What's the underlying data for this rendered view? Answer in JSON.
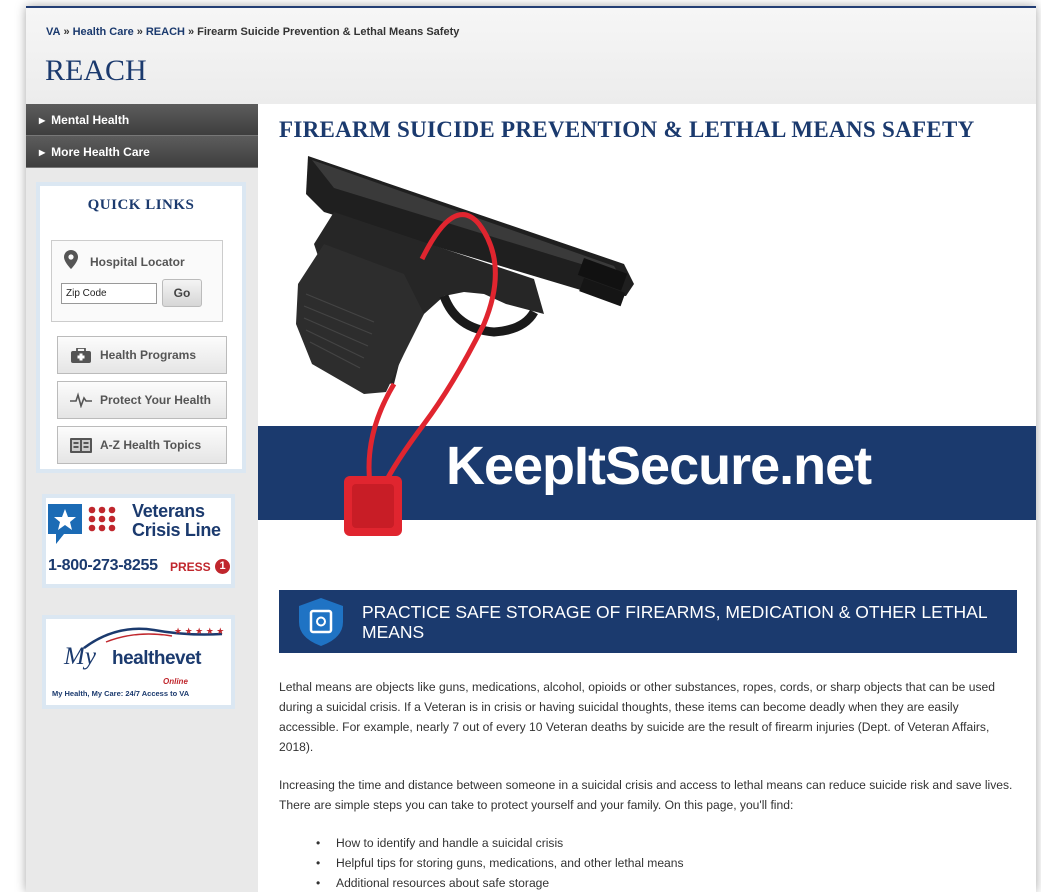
{
  "breadcrumb": {
    "items": [
      "VA",
      "Health Care",
      "REACH",
      "Firearm Suicide Prevention & Lethal Means Safety"
    ],
    "separator": "»"
  },
  "site": {
    "title": "REACH"
  },
  "sidebar": {
    "nav": [
      {
        "label": "Mental Health"
      },
      {
        "label": "More Health Care"
      }
    ],
    "quick_links": {
      "title": "QUICK LINKS",
      "locator": {
        "label": "Hospital Locator",
        "placeholder": "Zip Code",
        "go_label": "Go",
        "icon": "map-pin-icon"
      },
      "buttons": [
        {
          "label": "Health Programs",
          "icon": "first-aid-kit-icon"
        },
        {
          "label": "Protect Your Health",
          "icon": "heartbeat-icon"
        },
        {
          "label": "A-Z Health Topics",
          "icon": "az-topics-icon"
        }
      ]
    },
    "crisis_line": {
      "line1": "Veterans",
      "line2": "Crisis Line",
      "phone": "1-800-273-8255",
      "press": "PRESS",
      "press_number": "1"
    },
    "myhealthevet": {
      "logo_my": "My",
      "logo_name": "healthevet",
      "online": "Online",
      "tagline": "My Health, My Care: 24/7 Access to VA"
    }
  },
  "main": {
    "heading": "FIREARM SUICIDE PREVENTION & LETHAL MEANS SAFETY",
    "hero": {
      "text": "KeepItSecure.net"
    },
    "section": {
      "title": "PRACTICE SAFE STORAGE OF FIREARMS, MEDICATION & OTHER LETHAL MEANS",
      "icon": "safe-shield-icon"
    },
    "paragraphs": [
      "Lethal means are objects like guns, medications, alcohol, opioids or other substances, ropes, cords, or sharp objects that can be used during a suicidal crisis. If a Veteran is in crisis or having suicidal thoughts, these items can become deadly when they are easily accessible. For example, nearly 7 out of every 10 Veteran deaths by suicide are the result of firearm injuries (Dept. of Veteran Affairs, 2018).",
      "Increasing the time and distance between someone in a suicidal crisis and access to lethal means can reduce suicide risk and save lives. There are simple steps you can take to protect yourself and your family. On this page, you'll find:"
    ],
    "bullets": [
      "How to identify and handle a suicidal crisis",
      "Helpful tips for storing guns, medications, and other lethal means",
      "Additional resources about safe storage"
    ]
  },
  "colors": {
    "va_blue": "#1b3a6e",
    "crisis_red": "#c0272d",
    "lock_red": "#e0252f",
    "nav_gray": "#4a4a4a"
  }
}
